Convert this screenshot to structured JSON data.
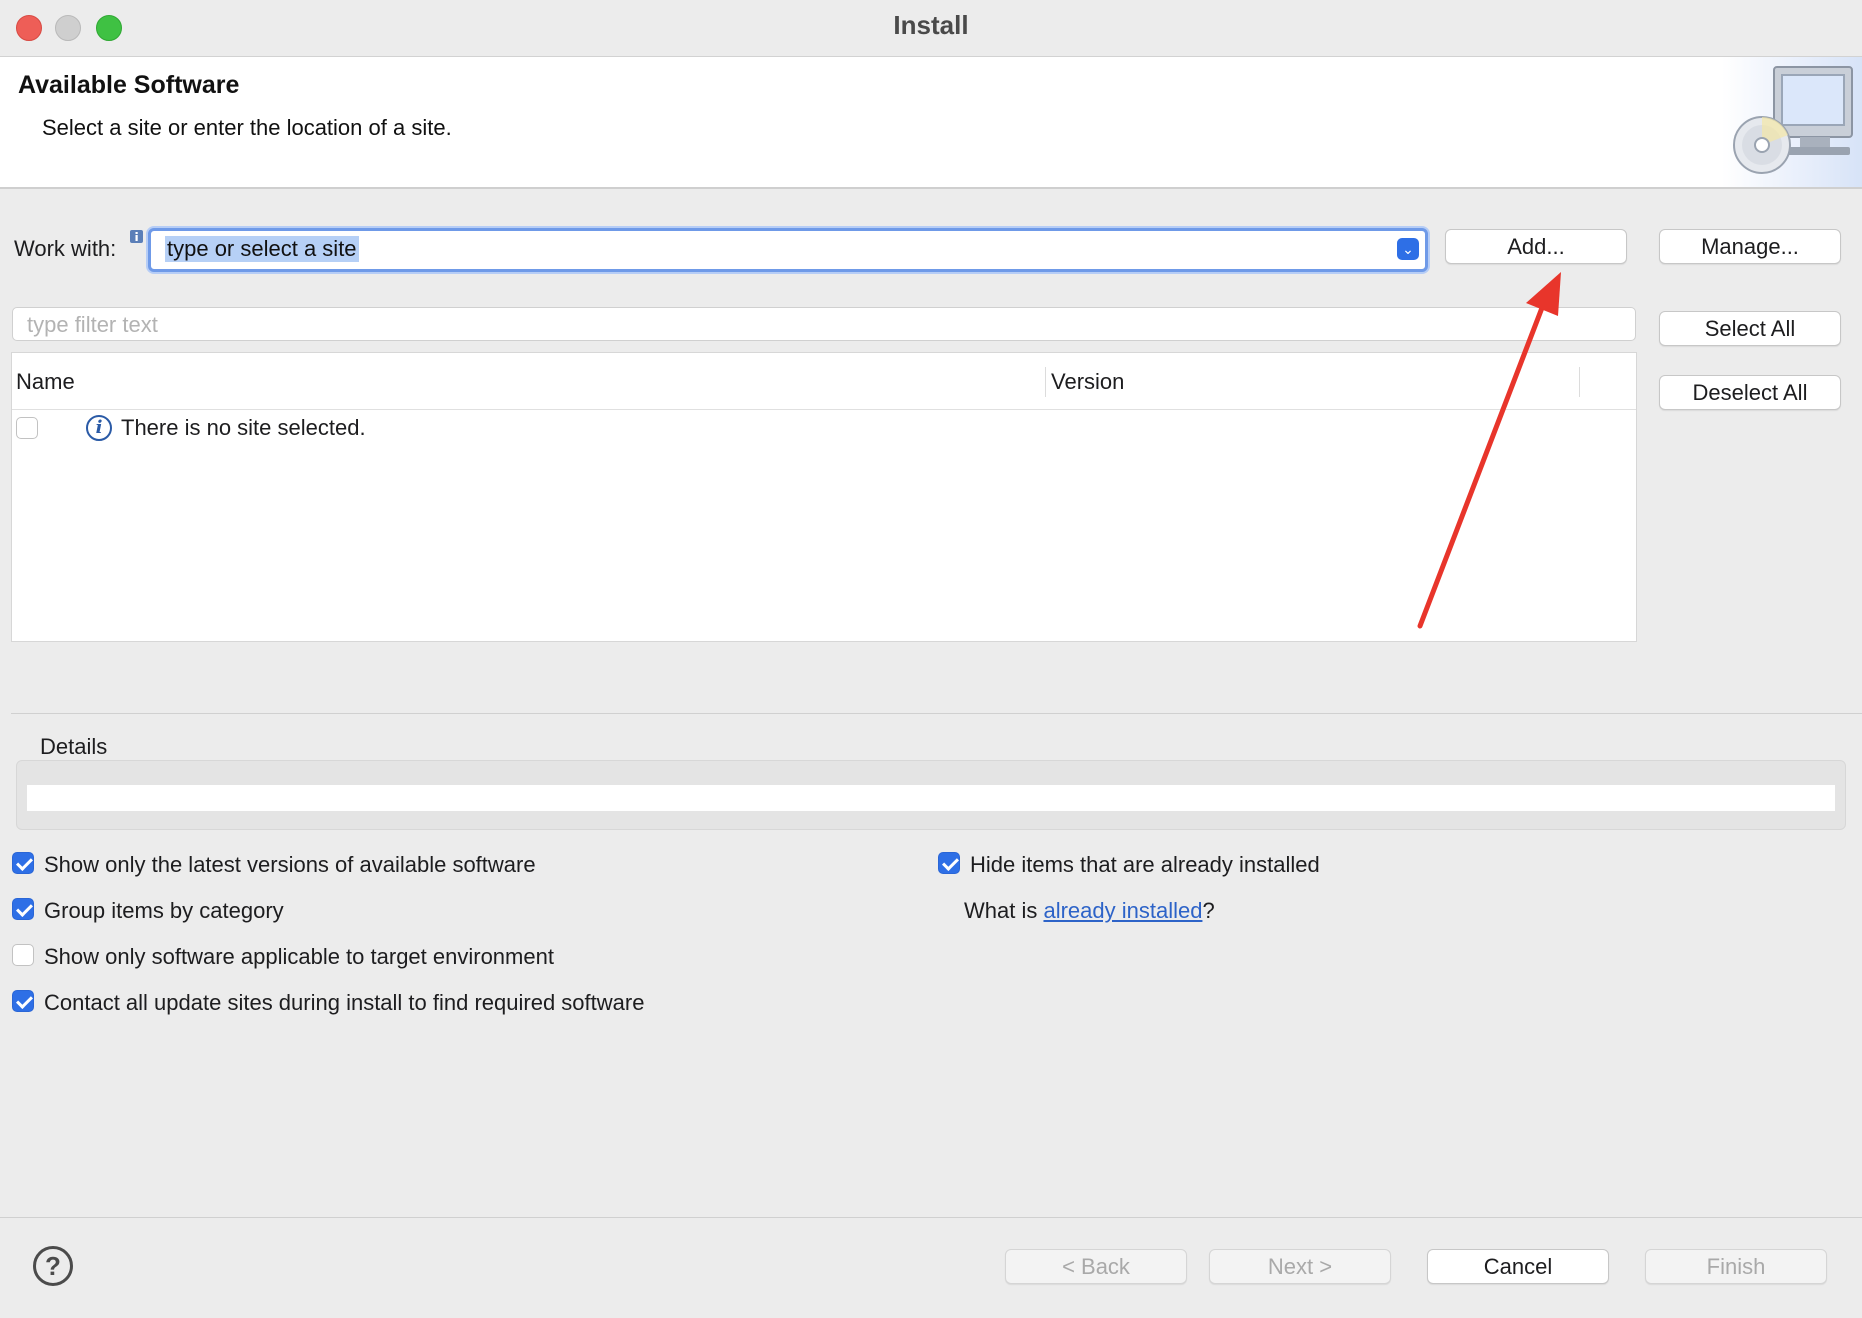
{
  "window": {
    "title": "Install"
  },
  "banner": {
    "title": "Available Software",
    "description": "Select a site or enter the location of a site."
  },
  "work_with": {
    "label": "Work with:",
    "value": "type or select a site",
    "add_label": "Add...",
    "manage_label": "Manage..."
  },
  "filter": {
    "placeholder": "type filter text"
  },
  "table": {
    "columns": [
      "Name",
      "Version"
    ],
    "rows": [
      {
        "checked": false,
        "text": "There is no site selected."
      }
    ]
  },
  "side_buttons": {
    "select_all": "Select All",
    "deselect_all": "Deselect All"
  },
  "details": {
    "label": "Details"
  },
  "options": {
    "left": [
      {
        "label": "Show only the latest versions of available software",
        "checked": true
      },
      {
        "label": "Group items by category",
        "checked": true
      },
      {
        "label": "Show only software applicable to target environment",
        "checked": false
      },
      {
        "label": "Contact all update sites during install to find required software",
        "checked": true
      }
    ],
    "hide_installed": {
      "label": "Hide items that are already installed",
      "checked": true
    },
    "what_is": {
      "prefix": "What is ",
      "link": "already installed",
      "suffix": "?"
    }
  },
  "footer": {
    "back": "< Back",
    "next": "Next >",
    "cancel": "Cancel",
    "finish": "Finish",
    "help_glyph": "?"
  },
  "colors": {
    "accent": "#2e6fe6",
    "annotation_arrow": "#e8352b",
    "link": "#2d63c8"
  }
}
